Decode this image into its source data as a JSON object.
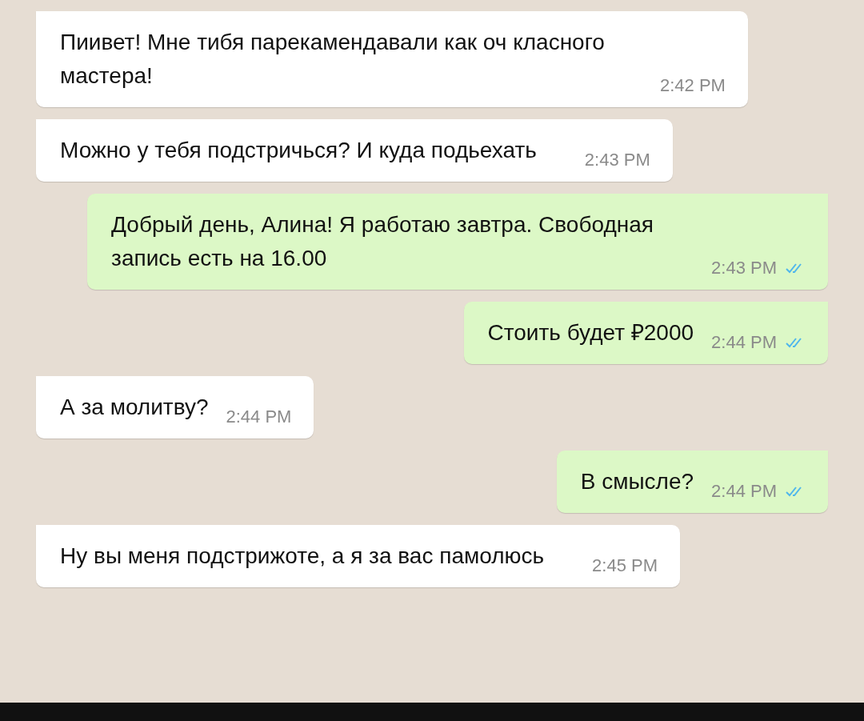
{
  "messages": [
    {
      "kind": "incoming",
      "text": "Пиивет! Мне тибя парекамендавали как оч класного мастера!",
      "time": "2:42 PM"
    },
    {
      "kind": "incoming",
      "text": "Можно у тебя подстричься? И куда подьехать",
      "time": "2:43 PM"
    },
    {
      "kind": "outgoing",
      "text": "Добрый день, Алина! Я работаю завтра. Свободная запись есть на 16.00",
      "time": "2:43 PM",
      "read": true
    },
    {
      "kind": "outgoing",
      "text": "Стоить будет ₽2000",
      "time": "2:44 PM",
      "read": true
    },
    {
      "kind": "incoming",
      "text": "А за молитву?",
      "time": "2:44 PM"
    },
    {
      "kind": "outgoing",
      "text": "В смысле?",
      "time": "2:44 PM",
      "read": true
    },
    {
      "kind": "incoming",
      "text": "Ну вы меня подстрижоте, а я за вас памолюсь",
      "time": "2:45 PM"
    }
  ]
}
